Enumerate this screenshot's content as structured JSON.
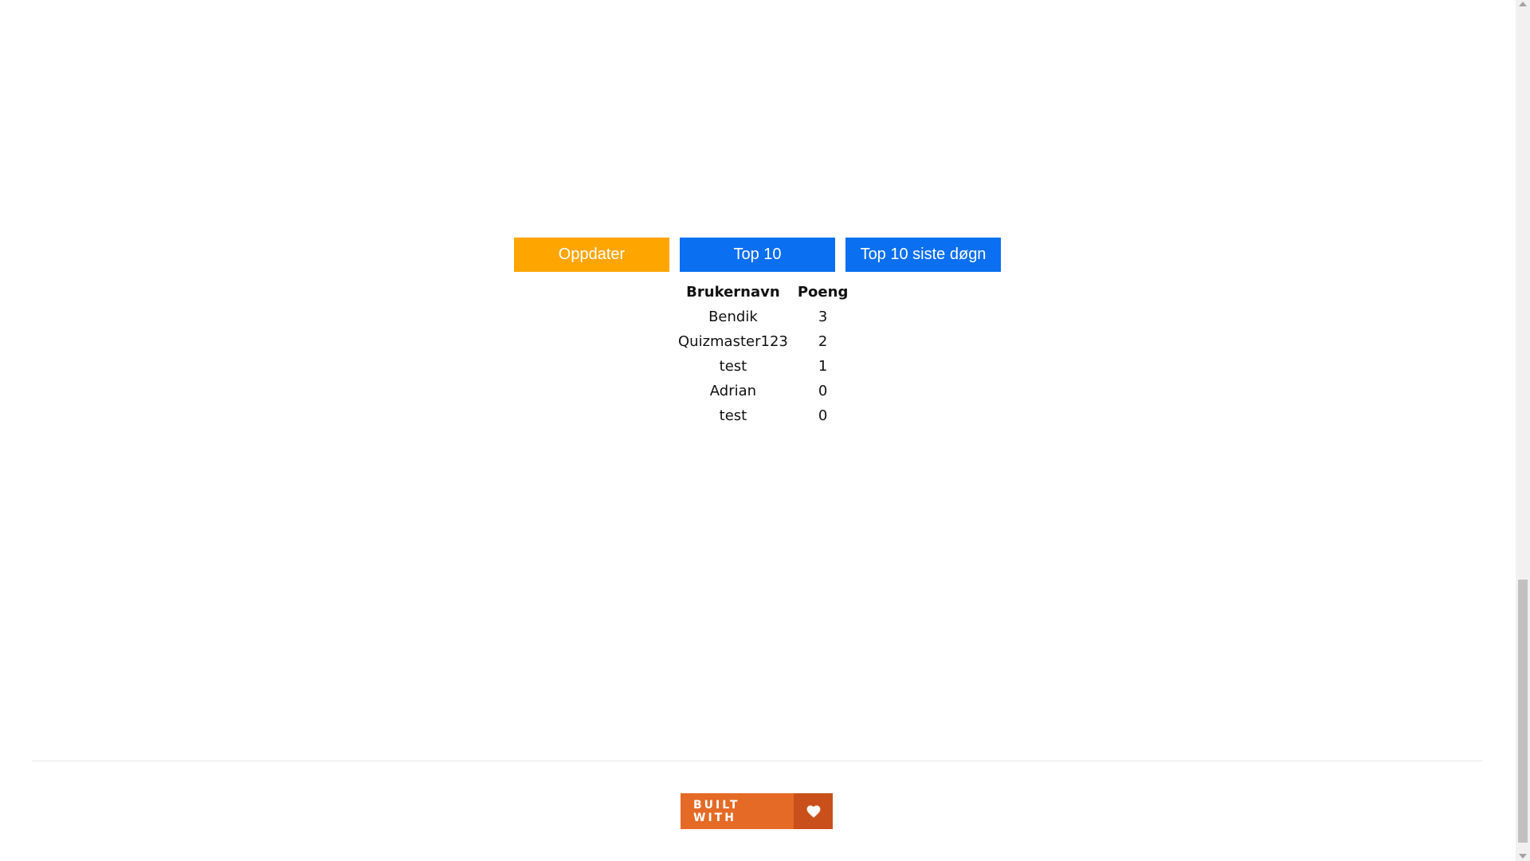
{
  "toolbar": {
    "update_label": "Oppdater",
    "top10_label": "Top 10",
    "top10_day_label": "Top 10 siste døgn"
  },
  "scoreboard": {
    "headers": [
      "Brukernavn",
      "Poeng"
    ],
    "rows": [
      {
        "username": "Bendik",
        "points": "3"
      },
      {
        "username": "Quizmaster123",
        "points": "2"
      },
      {
        "username": "test",
        "points": "1"
      },
      {
        "username": "Adrian",
        "points": "0"
      },
      {
        "username": "test",
        "points": "0"
      }
    ]
  },
  "footer": {
    "built_with_label": "BUILT WITH",
    "heart_icon": "heart-icon"
  },
  "colors": {
    "update_button": "#ffa500",
    "top_buttons": "#0a6ff0",
    "badge": "#e56a26",
    "badge_heart": "#c9501a"
  }
}
